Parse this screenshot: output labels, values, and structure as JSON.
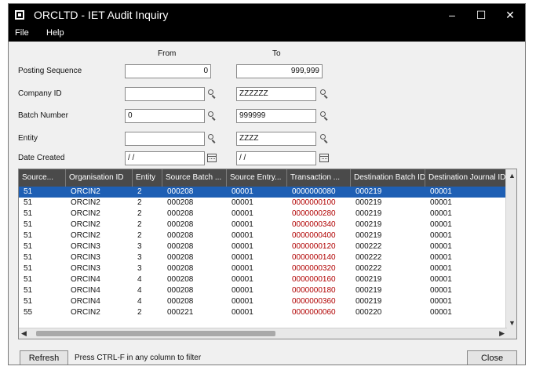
{
  "window": {
    "title": "ORCLTD - IET Audit Inquiry",
    "min_label": "–",
    "max_label": "☐",
    "close_label": "✕"
  },
  "menu": {
    "file": "File",
    "help": "Help"
  },
  "criteria": {
    "from_label": "From",
    "to_label": "To",
    "posting_sequence": {
      "label": "Posting Sequence",
      "from": "0",
      "to": "999,999"
    },
    "company_id": {
      "label": "Company ID",
      "from": "",
      "to": "ZZZZZZ"
    },
    "batch_number": {
      "label": "Batch Number",
      "from": "0",
      "to": "999999"
    },
    "entity": {
      "label": "Entity",
      "from": "",
      "to": "ZZZZ"
    },
    "date_created": {
      "label": "Date Created",
      "from": "/ /",
      "to": "/ /"
    }
  },
  "grid": {
    "columns": [
      "Source...",
      "Organisation ID",
      "Entity",
      "Source Batch ...",
      "Source Entry...",
      "Transaction ...",
      "Destination Batch ID",
      "Destination Journal ID"
    ],
    "selected_row": 0,
    "rows": [
      [
        "51",
        "ORCIN2",
        "2",
        "000208",
        "00001",
        "0000000080",
        "000219",
        "00001"
      ],
      [
        "51",
        "ORCIN2",
        "2",
        "000208",
        "00001",
        "0000000100",
        "000219",
        "00001"
      ],
      [
        "51",
        "ORCIN2",
        "2",
        "000208",
        "00001",
        "0000000280",
        "000219",
        "00001"
      ],
      [
        "51",
        "ORCIN2",
        "2",
        "000208",
        "00001",
        "0000000340",
        "000219",
        "00001"
      ],
      [
        "51",
        "ORCIN2",
        "2",
        "000208",
        "00001",
        "0000000400",
        "000219",
        "00001"
      ],
      [
        "51",
        "ORCIN3",
        "3",
        "000208",
        "00001",
        "0000000120",
        "000222",
        "00001"
      ],
      [
        "51",
        "ORCIN3",
        "3",
        "000208",
        "00001",
        "0000000140",
        "000222",
        "00001"
      ],
      [
        "51",
        "ORCIN3",
        "3",
        "000208",
        "00001",
        "0000000320",
        "000222",
        "00001"
      ],
      [
        "51",
        "ORCIN4",
        "4",
        "000208",
        "00001",
        "0000000160",
        "000219",
        "00001"
      ],
      [
        "51",
        "ORCIN4",
        "4",
        "000208",
        "00001",
        "0000000180",
        "000219",
        "00001"
      ],
      [
        "51",
        "ORCIN4",
        "4",
        "000208",
        "00001",
        "0000000360",
        "000219",
        "00001"
      ],
      [
        "55",
        "ORCIN2",
        "2",
        "000221",
        "00001",
        "0000000060",
        "000220",
        "00001"
      ]
    ]
  },
  "footer": {
    "refresh_label": "Refresh",
    "hint": "Press CTRL-F in any column to filter",
    "close_label": "Close"
  },
  "colors": {
    "accent": "#1e5fb4",
    "header_bg": "#4a4a4a",
    "title_bg": "#000000",
    "text_red": "#b00000"
  }
}
